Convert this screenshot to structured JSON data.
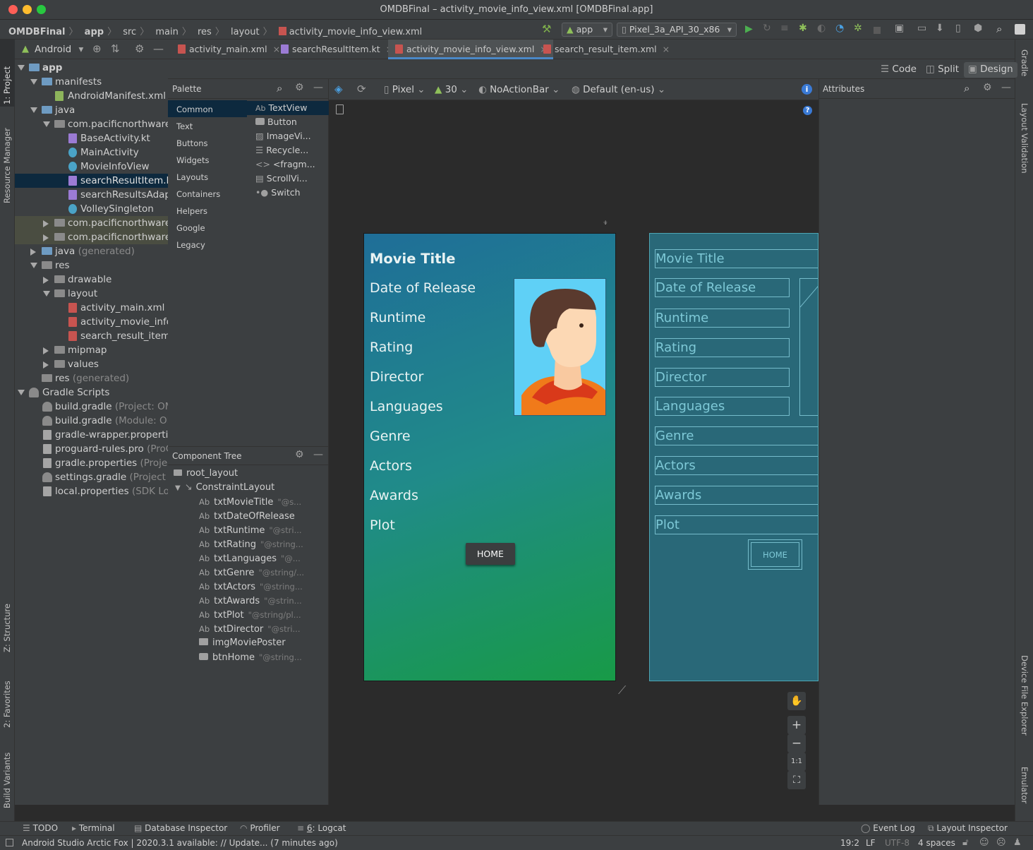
{
  "window": {
    "title": "OMDBFinal – activity_movie_info_view.xml [OMDBFinal.app]"
  },
  "breadcrumbs": [
    "OMDBFinal",
    "app",
    "src",
    "main",
    "res",
    "layout",
    "activity_movie_info_view.xml"
  ],
  "toolbar": {
    "run_config": "app",
    "device": "Pixel_3a_API_30_x86"
  },
  "left_strip": {
    "project": "1: Project",
    "resource_manager": "Resource Manager",
    "structure": "Z: Structure",
    "favorites": "2: Favorites",
    "build_variants": "Build Variants"
  },
  "right_strip": {
    "gradle": "Gradle",
    "layout_validation": "Layout Validation",
    "device_file_explorer": "Device File Explorer",
    "emulator": "Emulator"
  },
  "project_panel": {
    "view_mode": "Android",
    "tree": [
      {
        "label": "app",
        "extra": ""
      },
      {
        "label": "manifests",
        "extra": ""
      },
      {
        "label": "AndroidManifest.xml",
        "extra": ""
      },
      {
        "label": "java",
        "extra": ""
      },
      {
        "label": "com.pacificnorthware",
        "extra": ""
      },
      {
        "label": "BaseActivity.kt",
        "extra": ""
      },
      {
        "label": "MainActivity",
        "extra": ""
      },
      {
        "label": "MovieInfoView",
        "extra": ""
      },
      {
        "label": "searchResultItem.k",
        "extra": ""
      },
      {
        "label": "searchResultsAdap",
        "extra": ""
      },
      {
        "label": "VolleySingleton",
        "extra": ""
      },
      {
        "label": "com.pacificnorthware",
        "extra": ""
      },
      {
        "label": "com.pacificnorthware",
        "extra": ""
      },
      {
        "label": "java",
        "extra": "(generated)"
      },
      {
        "label": "res",
        "extra": ""
      },
      {
        "label": "drawable",
        "extra": ""
      },
      {
        "label": "layout",
        "extra": ""
      },
      {
        "label": "activity_main.xml",
        "extra": ""
      },
      {
        "label": "activity_movie_info",
        "extra": ""
      },
      {
        "label": "search_result_item",
        "extra": ""
      },
      {
        "label": "mipmap",
        "extra": ""
      },
      {
        "label": "values",
        "extra": ""
      },
      {
        "label": "res",
        "extra": "(generated)"
      },
      {
        "label": "Gradle Scripts",
        "extra": ""
      },
      {
        "label": "build.gradle",
        "extra": "(Project: OM"
      },
      {
        "label": "build.gradle",
        "extra": "(Module: OI"
      },
      {
        "label": "gradle-wrapper.propertie",
        "extra": ""
      },
      {
        "label": "proguard-rules.pro",
        "extra": "(ProG"
      },
      {
        "label": "gradle.properties",
        "extra": "(Projec"
      },
      {
        "label": "settings.gradle",
        "extra": "(Project S"
      },
      {
        "label": "local.properties",
        "extra": "(SDK Loc"
      }
    ]
  },
  "editor_tabs": [
    "activity_main.xml",
    "searchResultItem.kt",
    "activity_movie_info_view.xml",
    "search_result_item.xml"
  ],
  "mode_buttons": {
    "code": "Code",
    "split": "Split",
    "design": "Design"
  },
  "palette": {
    "title": "Palette",
    "categories": [
      "Common",
      "Text",
      "Buttons",
      "Widgets",
      "Layouts",
      "Containers",
      "Helpers",
      "Google",
      "Legacy"
    ],
    "items": [
      "TextView",
      "Button",
      "ImageVi...",
      "Recycle...",
      "<fragm...",
      "ScrollVi...",
      "Switch"
    ]
  },
  "design_toolbar": {
    "device": "Pixel",
    "api": "30",
    "theme": "NoActionBar",
    "locale": "Default (en-us)"
  },
  "component_tree": {
    "title": "Component Tree",
    "root": "root_layout",
    "layout": "ConstraintLayout",
    "children": [
      {
        "type": "Ab",
        "id": "txtMovieTitle",
        "ref": "\"@s..."
      },
      {
        "type": "Ab",
        "id": "txtDateOfRelease",
        "ref": ""
      },
      {
        "type": "Ab",
        "id": "txtRuntime",
        "ref": "\"@stri..."
      },
      {
        "type": "Ab",
        "id": "txtRating",
        "ref": "\"@string..."
      },
      {
        "type": "Ab",
        "id": "txtLanguages",
        "ref": "\"@..."
      },
      {
        "type": "Ab",
        "id": "txtGenre",
        "ref": "\"@string/..."
      },
      {
        "type": "Ab",
        "id": "txtActors",
        "ref": "\"@string..."
      },
      {
        "type": "Ab",
        "id": "txtAwards",
        "ref": "\"@strin..."
      },
      {
        "type": "Ab",
        "id": "txtPlot",
        "ref": "\"@string/pl..."
      },
      {
        "type": "Ab",
        "id": "txtDirector",
        "ref": "\"@stri..."
      },
      {
        "type": "",
        "id": "imgMoviePoster",
        "ref": ""
      },
      {
        "type": "",
        "id": "btnHome",
        "ref": "\"@string..."
      }
    ]
  },
  "preview": {
    "title": "Movie Title",
    "fields": [
      "Date of Release",
      "Runtime",
      "Rating",
      "Director",
      "Languages",
      "Genre",
      "Actors",
      "Awards",
      "Plot"
    ],
    "button": "HOME"
  },
  "blueprint": {
    "fields": [
      "Movie Title",
      "Date of Release",
      "Runtime",
      "Rating",
      "Director",
      "Languages",
      "Genre",
      "Actors",
      "Awards",
      "Plot"
    ],
    "button": "HOME"
  },
  "zoom_controls": {
    "ratio": "1:1"
  },
  "attributes": {
    "title": "Attributes"
  },
  "bottom_tabs": {
    "todo": "TODO",
    "terminal": "Terminal",
    "database": "Database Inspector",
    "profiler": "Profiler",
    "logcat_num": "6",
    "logcat": ": Logcat",
    "event_log": "Event Log",
    "layout_inspector": "Layout Inspector"
  },
  "status": {
    "message": "Android Studio Arctic Fox | 2020.3.1 available: // Update... (7 minutes ago)",
    "position": "19:2",
    "line_sep": "LF",
    "encoding": "UTF-8",
    "indent": "4 spaces"
  }
}
